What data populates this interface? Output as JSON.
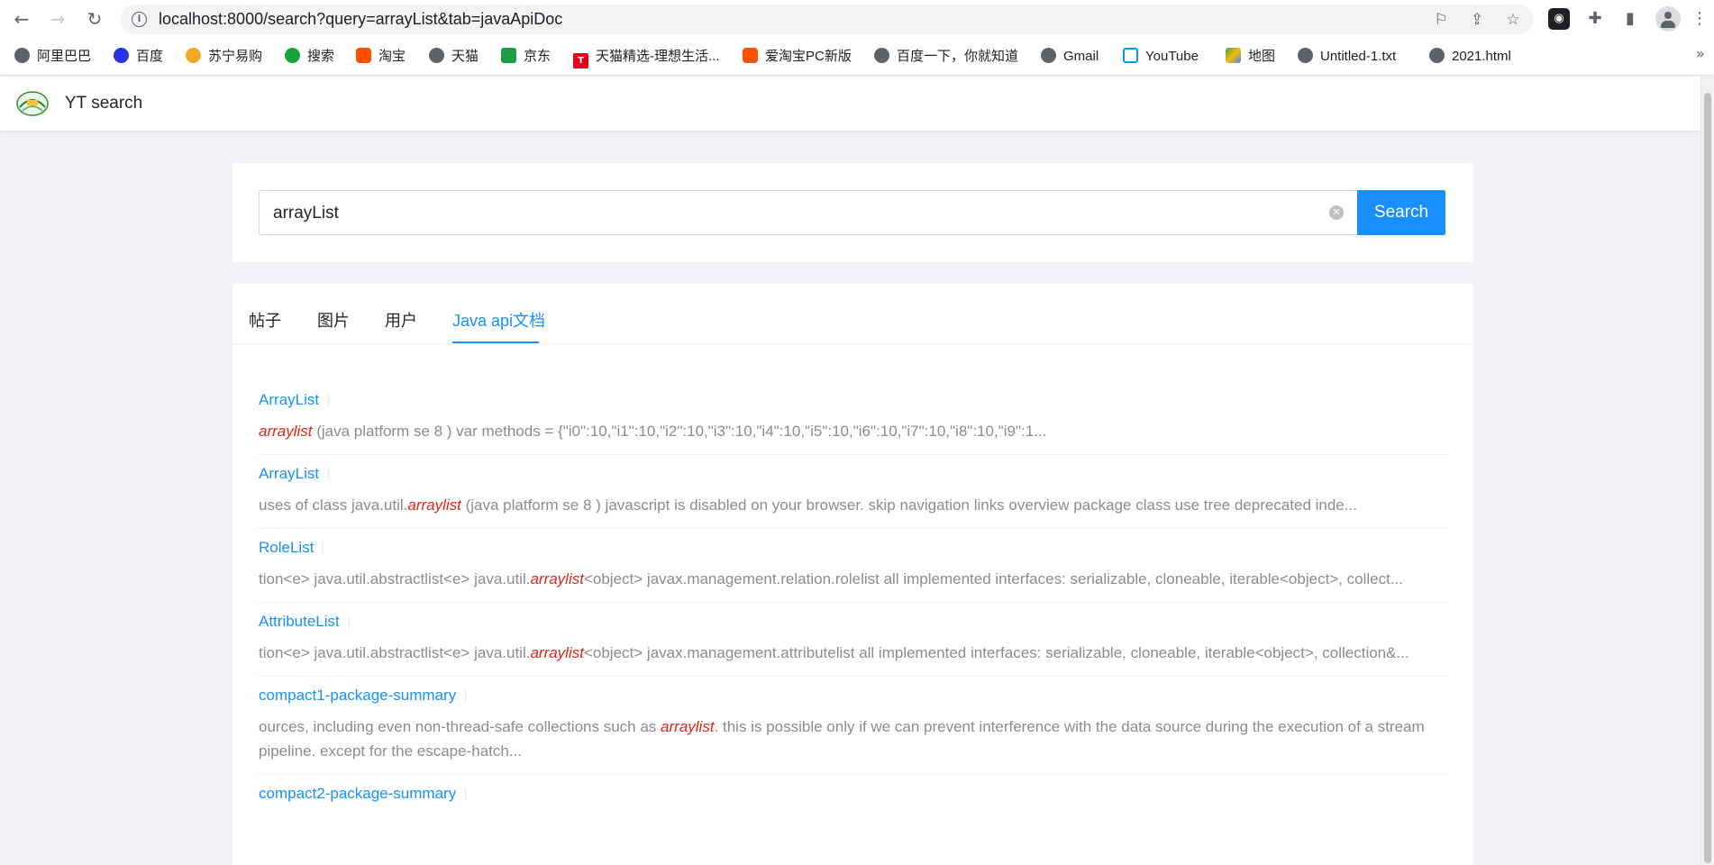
{
  "browser": {
    "url": "localhost:8000/search?query=arrayList&tab=javaApiDoc",
    "bookmarks": [
      {
        "label": "阿里巴巴",
        "icon": "globe-icon"
      },
      {
        "label": "百度",
        "icon": "baidu-paw-icon"
      },
      {
        "label": "苏宁易购",
        "icon": "suning-icon"
      },
      {
        "label": "搜索",
        "icon": "sousuo-icon"
      },
      {
        "label": "淘宝",
        "icon": "taobao-icon"
      },
      {
        "label": "天猫",
        "icon": "globe-icon"
      },
      {
        "label": "京东",
        "icon": "jd-icon"
      },
      {
        "label": "天猫精选-理想生活...",
        "icon": "tmall-icon"
      },
      {
        "label": "爱淘宝PC新版",
        "icon": "taobao-icon"
      },
      {
        "label": "百度一下，你就知道",
        "icon": "globe-icon"
      },
      {
        "label": "Gmail",
        "icon": "globe-icon"
      },
      {
        "label": "YouTube",
        "icon": "bilibili-tv-icon"
      },
      {
        "label": "地图",
        "icon": "maps-icon"
      },
      {
        "label": "Untitled-1.txt",
        "icon": "globe-icon"
      },
      {
        "label": "2021.html",
        "icon": "globe-icon"
      }
    ]
  },
  "app": {
    "title": "YT search"
  },
  "search": {
    "value": "arrayList",
    "button_label": "Search"
  },
  "tabs": [
    {
      "label": "帖子",
      "active": false
    },
    {
      "label": "图片",
      "active": false
    },
    {
      "label": "用户",
      "active": false
    },
    {
      "label": "Java api文档",
      "active": true
    }
  ],
  "results": [
    {
      "title": "ArrayList",
      "pre": "",
      "highlight": "arraylist",
      "post": " (java platform se 8 ) var methods = {\"i0\":10,\"i1\":10,\"i2\":10,\"i3\":10,\"i4\":10,\"i5\":10,\"i6\":10,\"i7\":10,\"i8\":10,\"i9\":1..."
    },
    {
      "title": "ArrayList",
      "pre": "uses of class java.util.",
      "highlight": "arraylist",
      "post": " (java platform se 8 ) javascript is disabled on your browser. skip navigation links overview package class use tree deprecated inde..."
    },
    {
      "title": "RoleList",
      "pre": "tion<e> java.util.abstractlist<e> java.util.",
      "highlight": "arraylist",
      "post": "<object> javax.management.relation.rolelist all implemented interfaces: serializable, cloneable, iterable<object>, collect..."
    },
    {
      "title": "AttributeList",
      "pre": "tion<e> java.util.abstractlist<e> java.util.",
      "highlight": "arraylist",
      "post": "<object> javax.management.attributelist all implemented interfaces: serializable, cloneable, iterable<object>, collection&..."
    },
    {
      "title": "compact1-package-summary",
      "pre": "ources, including even non-thread-safe collections such as ",
      "highlight": "arraylist",
      "post": ". this is possible only if we can prevent interference with the data source during the execution of a stream pipeline. except for the escape-hatch..."
    },
    {
      "title": "compact2-package-summary",
      "pre": "",
      "highlight": "",
      "post": ""
    }
  ],
  "colors": {
    "primary": "#1890ff",
    "highlight": "#e0261c",
    "background": "#f0f2f5"
  }
}
